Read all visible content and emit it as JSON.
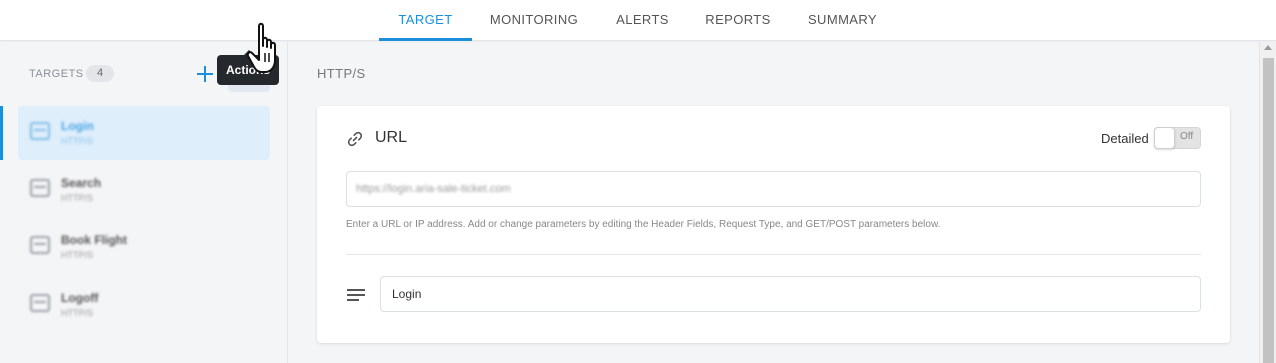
{
  "tabs": [
    {
      "label": "TARGET",
      "active": true
    },
    {
      "label": "MONITORING",
      "active": false
    },
    {
      "label": "ALERTS",
      "active": false
    },
    {
      "label": "REPORTS",
      "active": false
    },
    {
      "label": "SUMMARY",
      "active": false
    }
  ],
  "sidebar": {
    "header_label": "TARGETS",
    "count": "4",
    "add_icon": "plus-icon",
    "actions_icon": "more-vertical-icon",
    "actions_tooltip": "Actions",
    "items": [
      {
        "name": "Login",
        "type": "HTTP/S",
        "selected": true
      },
      {
        "name": "Search",
        "type": "HTTP/S",
        "selected": false
      },
      {
        "name": "Book Flight",
        "type": "HTTP/S",
        "selected": false
      },
      {
        "name": "Logoff",
        "type": "HTTP/S",
        "selected": false
      }
    ]
  },
  "main": {
    "section_title": "HTTP/S",
    "card": {
      "title": "URL",
      "title_icon": "link-icon",
      "detailed_label": "Detailed",
      "toggle_state": "Off",
      "url_value": "https://login.aria-sale-ticket.com",
      "hint": "Enter a URL or IP address. Add or change parameters by editing the Header Fields, Request Type, and GET/POST parameters below.",
      "name_icon": "text-lines-icon",
      "name_value": "Login"
    }
  },
  "colors": {
    "accent": "#1c8fdc",
    "selected_bg": "#deeefb",
    "tooltip_bg": "#25292e"
  }
}
